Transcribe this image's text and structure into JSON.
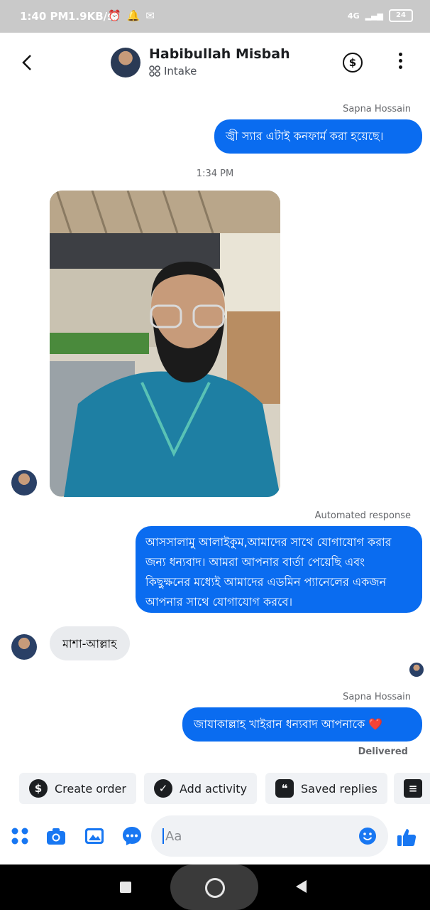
{
  "status_bar": {
    "time": "1:40 PM",
    "speed": "1.9KB/s",
    "network": "4G",
    "battery": "24"
  },
  "header": {
    "contact_name": "Habibullah Misbah",
    "subtitle": "Intake"
  },
  "messages": {
    "m1_sender": "Sapna Hossain",
    "m1_text": "জ্বী স্যার এটাই কনফার্ম করা হয়েছে।",
    "timestamp": "1:34 PM",
    "auto_label": "Automated response",
    "auto_text": "আসসালামু আলাইকুম,আমাদের সাথে যোগাযোগ করার জন্য ধন্যবাদ। আমরা আপনার বার্তা পেয়েছি এবং কিছুক্ষনের মধ্যেই আমাদের এডমিন প্যানেলের একজন আপনার সাথে যোগাযোগ করবে।",
    "incoming_text": "মাশা-আল্লাহ",
    "m2_sender": "Sapna Hossain",
    "m2_text": "জাযাকাল্লাহ খাইরান ধন্যবাদ আপনাকে ❤️",
    "delivered": "Delivered"
  },
  "quick_actions": [
    {
      "label": "Create order",
      "icon": "dollar-icon"
    },
    {
      "label": "Add activity",
      "icon": "check-icon"
    },
    {
      "label": "Saved replies",
      "icon": "chat-bubbles-icon"
    }
  ],
  "composer": {
    "placeholder": "Aa"
  },
  "colors": {
    "accent": "#0a6cf0",
    "incoming_bubble": "#e9ebee",
    "chip_bg": "#f0f2f5",
    "status_bar": "#c9c9c9"
  }
}
